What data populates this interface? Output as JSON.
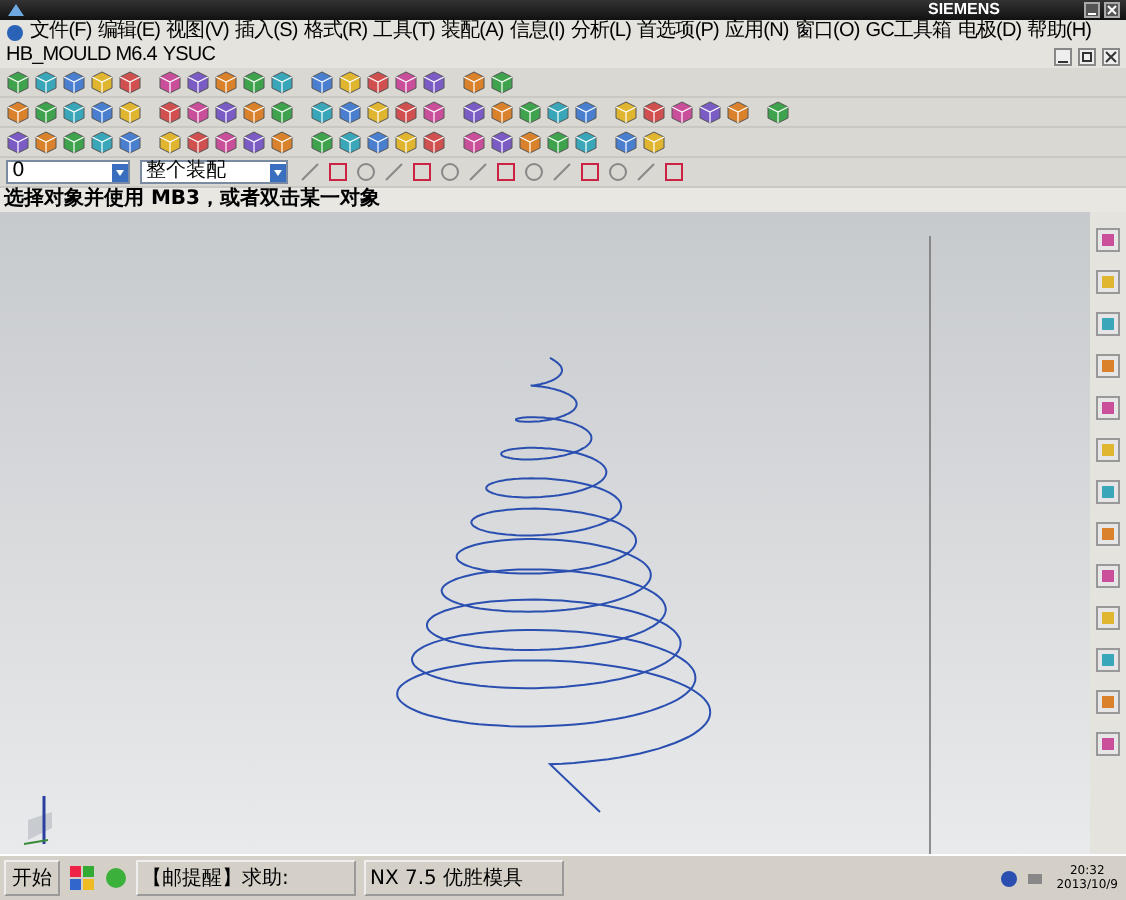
{
  "window": {
    "brand": "SIEMENS"
  },
  "menu": [
    "文件(F)",
    "编辑(E)",
    "视图(V)",
    "插入(S)",
    "格式(R)",
    "工具(T)",
    "装配(A)",
    "信息(I)",
    "分析(L)",
    "首选项(P)",
    "应用(N)",
    "窗口(O)",
    "GC工具箱",
    "电极(D)",
    "帮助(H)",
    "HB_MOULD M6.4",
    "YSUC"
  ],
  "selection_bar": {
    "filter": "0",
    "scope": "整个装配"
  },
  "status_prompt": "选择对象并使用 MB3，或者双击某一对象",
  "taskbar": {
    "start": "开始",
    "tasks": [
      {
        "label": "【邮提醒】求助:",
        "selected": false
      },
      {
        "label": "NX 7.5 优胜模具",
        "selected": false
      }
    ],
    "time": "20:32",
    "date": "2013/10/9"
  }
}
